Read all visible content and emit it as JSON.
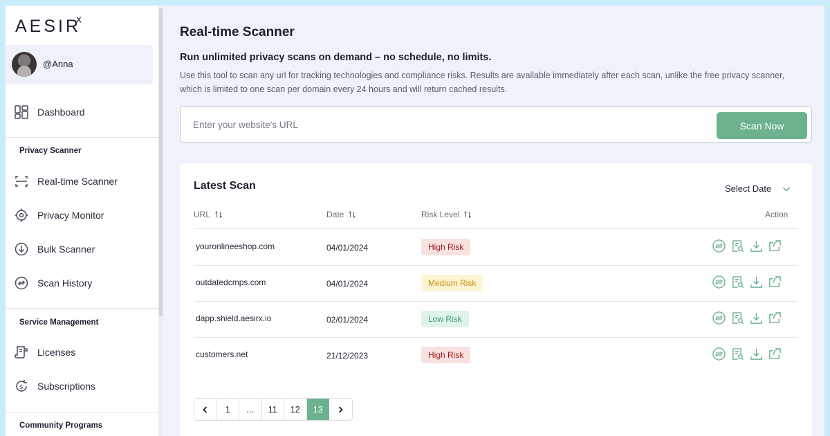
{
  "brand": {
    "logo_text": "AESIR",
    "logo_mark": "ᕁ"
  },
  "user": {
    "handle": "@Anna"
  },
  "sidebar": {
    "dashboard": {
      "label": "Dashboard",
      "icon": "dashboard-icon"
    },
    "sections": [
      {
        "title": "Privacy Scanner"
      },
      {
        "title": "Service Management"
      },
      {
        "title": "Community Programs"
      }
    ],
    "items": [
      {
        "label": "Real-time Scanner",
        "icon": "scan-icon"
      },
      {
        "label": "Privacy Monitor",
        "icon": "target-icon"
      },
      {
        "label": "Bulk Scanner",
        "icon": "download-circle-icon"
      },
      {
        "label": "Scan History",
        "icon": "history-icon"
      },
      {
        "label": "Licenses",
        "icon": "license-icon"
      },
      {
        "label": "Subscriptions",
        "icon": "subscription-icon"
      }
    ]
  },
  "main": {
    "title": "Real-time Scanner",
    "subtitle": "Run unlimited privacy scans on demand – no schedule, no limits.",
    "description": "Use this tool to scan any url for tracking technologies and compliance risks. Results are available immediately after each scan, unlike the free privacy scanner, which is limited to one scan per domain every 24 hours and will return cached results.",
    "search": {
      "placeholder": "Enter your website's URL",
      "value": "",
      "button_label": "Scan Now"
    }
  },
  "latest_scan": {
    "title": "Latest Scan",
    "date_filter": "Select Date",
    "columns": {
      "url": "URL",
      "date": "Date",
      "risk": "Risk Level",
      "action": "Action"
    },
    "rows": [
      {
        "url": "youronlineeshop.com",
        "date": "04/01/2024",
        "risk": "High Risk"
      },
      {
        "url": "outdatedcmps.com",
        "date": "04/01/2024",
        "risk": "Medium Risk"
      },
      {
        "url": "dapp.shield.aesirx.io",
        "date": "02/01/2024",
        "risk": "Low Risk"
      },
      {
        "url": "customers.net",
        "date": "21/12/2023",
        "risk": "High Risk"
      }
    ],
    "risk_colors": {
      "High Risk": {
        "bg": "#f9e1e1",
        "fg": "#9b1c1c"
      },
      "Medium Risk": {
        "bg": "#fdf4d3",
        "fg": "#c98b12"
      },
      "Low Risk": {
        "bg": "#dff3e8",
        "fg": "#3d9a6a"
      }
    },
    "pagination": {
      "pages": [
        "1",
        "…",
        "11",
        "12",
        "13"
      ],
      "active": "13"
    }
  },
  "colors": {
    "accent": "#6db28f",
    "background": "#f0f2fb",
    "frame": "#c9ecfb"
  }
}
